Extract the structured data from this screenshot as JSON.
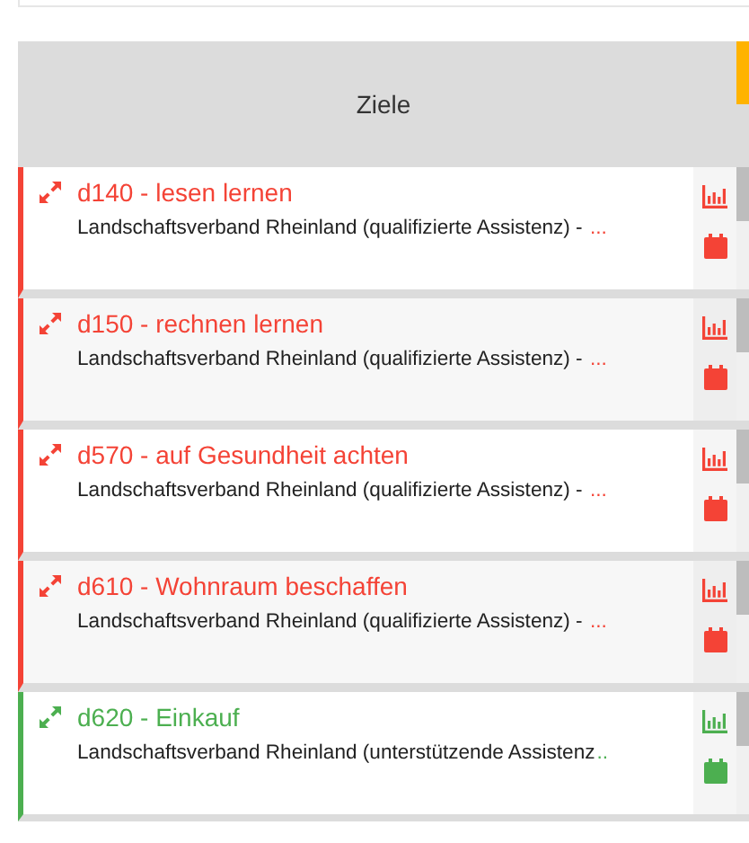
{
  "header": {
    "title": "Ziele"
  },
  "goals": [
    {
      "title": "d140 - lesen lernen",
      "subtitle": "Landschaftsverband Rheinland (qualifizierte Assistenz) - ",
      "more": "...",
      "color": "#f44336"
    },
    {
      "title": "d150 - rechnen lernen",
      "subtitle": "Landschaftsverband Rheinland (qualifizierte Assistenz) - ",
      "more": "...",
      "color": "#f44336"
    },
    {
      "title": "d570 - auf Gesundheit achten",
      "subtitle": "Landschaftsverband Rheinland (qualifizierte Assistenz) - ",
      "more": "...",
      "color": "#f44336"
    },
    {
      "title": "d610 - Wohnraum beschaffen",
      "subtitle": "Landschaftsverband Rheinland (qualifizierte Assistenz) - ",
      "more": "...",
      "color": "#f44336"
    },
    {
      "title": "d620 - Einkauf",
      "subtitle": "Landschaftsverband Rheinland (unterstützende Assistenz",
      "more": "..",
      "color": "#4caf50"
    }
  ]
}
